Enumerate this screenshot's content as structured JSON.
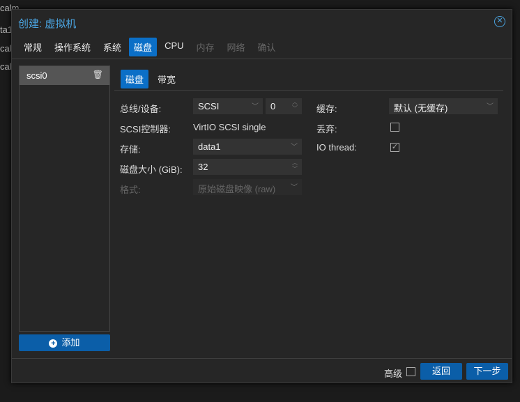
{
  "background_text": [
    "calm",
    "ta1",
    "cal",
    "cal-"
  ],
  "dialog": {
    "title": "创建: 虚拟机",
    "close_icon": "close-circle-icon"
  },
  "tabs": [
    {
      "label": "常规"
    },
    {
      "label": "操作系统"
    },
    {
      "label": "系统"
    },
    {
      "label": "磁盘"
    },
    {
      "label": "CPU"
    },
    {
      "label": "内存"
    },
    {
      "label": "网络"
    },
    {
      "label": "确认"
    }
  ],
  "disk_list": {
    "items": [
      {
        "label": "scsi0"
      }
    ],
    "add_label": "添加"
  },
  "subtabs": [
    {
      "label": "磁盘"
    },
    {
      "label": "带宽"
    }
  ],
  "form": {
    "bus_label": "总线/设备:",
    "bus_value": "SCSI",
    "device_value": "0",
    "controller_label": "SCSI控制器:",
    "controller_value": "VirtIO SCSI single",
    "storage_label": "存储:",
    "storage_value": "data1",
    "size_label": "磁盘大小 (GiB):",
    "size_value": "32",
    "format_label": "格式:",
    "format_value": "原始磁盘映像 (raw)",
    "cache_label": "缓存:",
    "cache_value": "默认 (无缓存)",
    "discard_label": "丢弃:",
    "discard_checked": false,
    "iothread_label": "IO thread:",
    "iothread_checked": true
  },
  "footer": {
    "advanced_label": "高级",
    "back_label": "返回",
    "next_label": "下一步"
  }
}
